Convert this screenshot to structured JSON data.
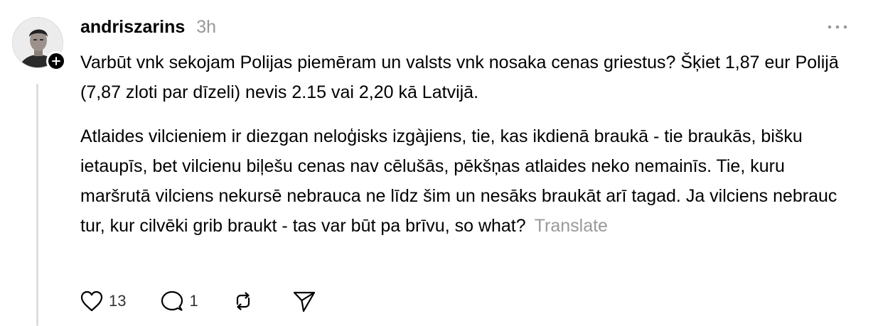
{
  "post": {
    "username": "andriszarins",
    "timestamp": "3h",
    "paragraphs": [
      "Varbūt vnk sekojam Polijas piemēram un valsts vnk nosaka cenas griestus? Šķiet 1,87 eur Polijā (7,87 zloti par dīzeli) nevis 2.15 vai 2,20 kā Latvijā.",
      "Atlaides vilcieniem ir diezgan neloģisks izgàjiens, tie, kas ikdienā braukā - tie braukās, bišku ietaupīs, bet vilcienu biļešu cenas nav cēlušās, pēkšņas atlaides neko nemainīs. Tie, kuru maršrutā vilciens nekursē nebrauca ne līdz šim un nesāks braukāt arī tagad. Ja vilciens nebrauc tur, kur cilvēki grib braukt - tas var būt pa brīvu, so what?"
    ],
    "translate_label": "Translate",
    "like_count": "13",
    "reply_count": "1"
  },
  "icons": {
    "avatar": "profile-photo",
    "follow": "plus-icon",
    "more": "more-dots-icon",
    "like": "heart-icon",
    "reply": "speech-bubble-icon",
    "repost": "repost-icon",
    "share": "send-icon"
  }
}
